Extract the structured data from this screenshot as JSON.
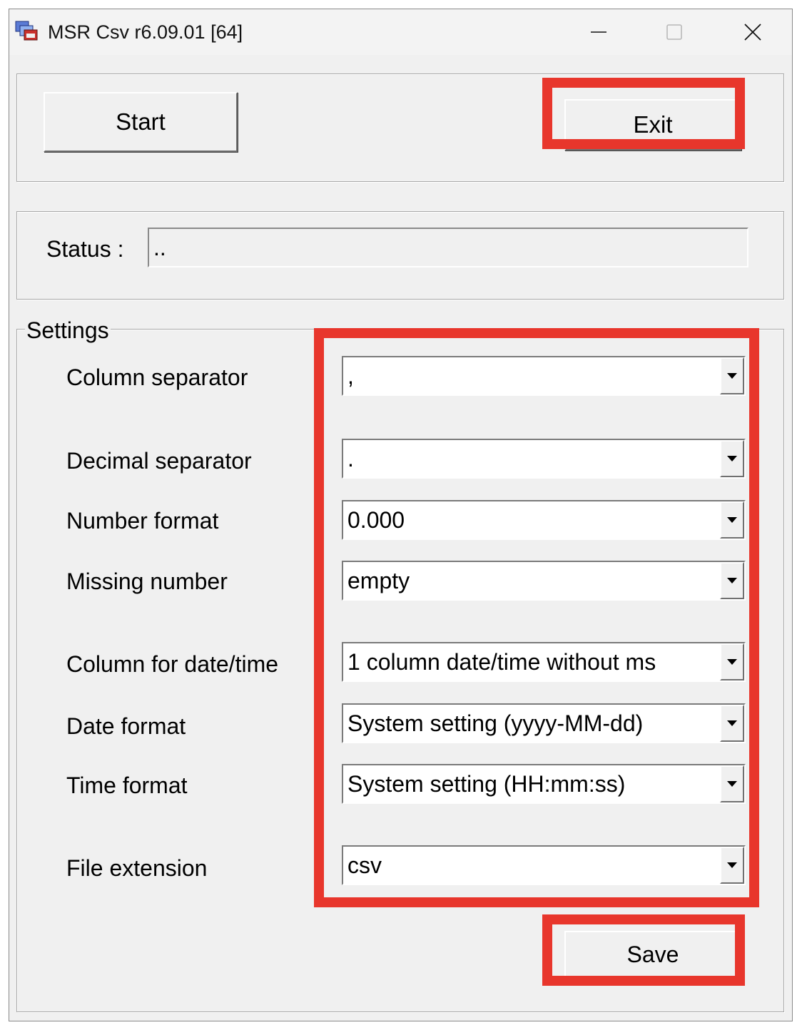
{
  "window": {
    "title": "MSR Csv r6.09.01 [64]"
  },
  "toolbar": {
    "start_label": "Start",
    "exit_label": "Exit"
  },
  "status": {
    "label": "Status :",
    "value": ".."
  },
  "settings": {
    "legend": "Settings",
    "fields": [
      {
        "label": "Column separator",
        "value": ","
      },
      {
        "label": "Decimal separator",
        "value": "."
      },
      {
        "label": "Number format",
        "value": "0.000"
      },
      {
        "label": "Missing number",
        "value": "empty"
      },
      {
        "label": "Column for date/time",
        "value": "1 column date/time without ms"
      },
      {
        "label": "Date format",
        "value": "System setting (yyyy-MM-dd)"
      },
      {
        "label": "Time format",
        "value": "System setting (HH:mm:ss)"
      },
      {
        "label": "File extension",
        "value": "csv"
      }
    ],
    "save_label": "Save"
  },
  "colors": {
    "highlight": "#e8362c",
    "window_bg": "#f0f0f0"
  },
  "icons": {
    "app": "app-icon",
    "minimize": "minimize-icon",
    "maximize": "maximize-icon",
    "close": "close-icon",
    "dropdown": "chevron-down-icon"
  }
}
